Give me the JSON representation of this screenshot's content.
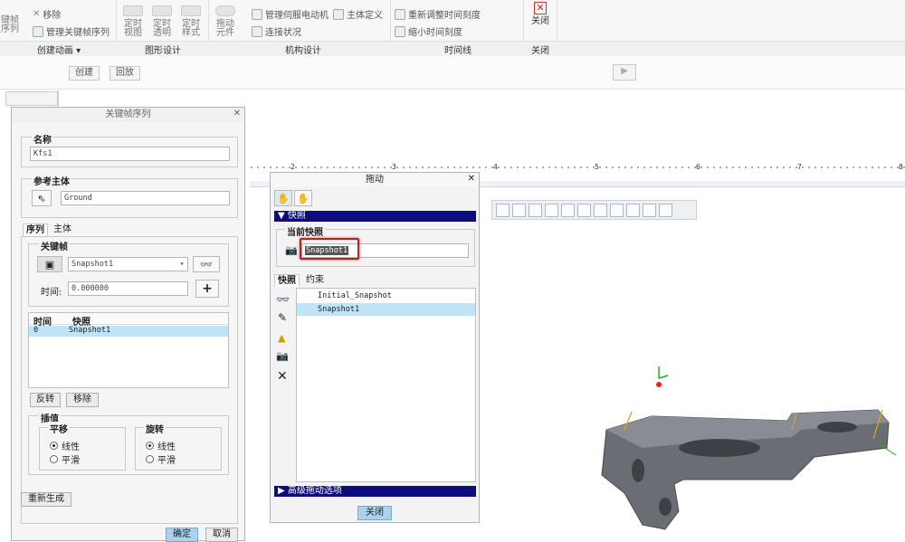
{
  "ribbon": {
    "create_anim_top": [
      "键帧",
      "序列"
    ],
    "remove": "移除",
    "manage_keyframe": "管理关键帧序列",
    "timed_view": [
      "定时",
      "视图"
    ],
    "timed_trans": [
      "定时",
      "透明"
    ],
    "timed_style": [
      "定时",
      "样式"
    ],
    "drag": [
      "拖动",
      "元件"
    ],
    "manage_servo": "管理伺服电动机",
    "body_define": "主体定义",
    "connect_status": "连接状况",
    "rescale_time": "重新调整时间刻度",
    "shrink_time": "缩小时间刻度",
    "close": "关闭",
    "groups": {
      "create_anim": "创建动画 ▾",
      "graphic": "图形设计",
      "mechanism": "机构设计",
      "timeline": "时间线",
      "close": "关闭"
    }
  },
  "subbar": {
    "create": "创建",
    "playback": "回放"
  },
  "keyframe_dialog": {
    "title": "关键帧序列",
    "name_label": "名称",
    "name_value": "Kfs1",
    "ref_body_label": "参考主体",
    "ref_body_value": "Ground",
    "tabs": [
      "序列",
      "主体"
    ],
    "keyframe_label": "关键帧",
    "keyframe_select": "Snapshot1",
    "time_label": "时间:",
    "time_value": "0.000000",
    "table_headers": [
      "时间",
      "快照"
    ],
    "table_rows": [
      [
        "0",
        "Snapshot1"
      ]
    ],
    "reverse": "反转",
    "remove": "移除",
    "interp_label": "插值",
    "translate_label": "平移",
    "rotate_label": "旋转",
    "linear": "线性",
    "smooth": "平滑",
    "regenerate": "重新生成",
    "ok": "确定",
    "cancel": "取消"
  },
  "drag_dialog": {
    "title": "拖动",
    "snapshot_header": "快照",
    "current_snapshot_label": "当前快照",
    "current_snapshot_value": "Snapshot1",
    "tabs": [
      "快照",
      "约束"
    ],
    "snapshots": [
      "Initial_Snapshot",
      "Snapshot1"
    ],
    "advanced": "高级拖动选项",
    "close": "关闭"
  },
  "ruler": {
    "ticks": [
      "2",
      "3",
      "4",
      "5",
      "6",
      "7",
      "8"
    ]
  }
}
